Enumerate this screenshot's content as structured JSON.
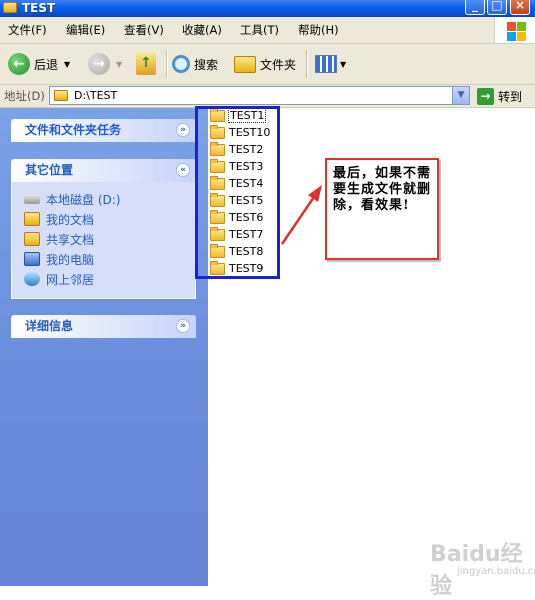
{
  "window": {
    "title": "TEST"
  },
  "menu": {
    "items": [
      "文件(F)",
      "编辑(E)",
      "查看(V)",
      "收藏(A)",
      "工具(T)",
      "帮助(H)"
    ]
  },
  "toolbar": {
    "back_label": "后退",
    "search_label": "搜索",
    "folders_label": "文件夹"
  },
  "address": {
    "label": "地址(D)",
    "path": "D:\\TEST",
    "go_label": "转到"
  },
  "sidebar": {
    "tasks_title": "文件和文件夹任务",
    "places_title": "其它位置",
    "places": [
      "本地磁盘 (D:)",
      "我的文档",
      "共享文档",
      "我的电脑",
      "网上邻居"
    ],
    "details_title": "详细信息"
  },
  "files": [
    "TEST1",
    "TEST10",
    "TEST2",
    "TEST3",
    "TEST4",
    "TEST5",
    "TEST6",
    "TEST7",
    "TEST8",
    "TEST9"
  ],
  "annotation": {
    "text": "最后，如果不需要生成文件就删除，看效果!"
  },
  "watermark": {
    "brand": "Baidu经验",
    "url": "jingyan.baidu.com"
  },
  "colors": {
    "titlebar": "#0a5fe8",
    "sidebar": "#6b8fdd",
    "highlight_box": "#1f1fd6",
    "annotation_border": "#e03030"
  }
}
